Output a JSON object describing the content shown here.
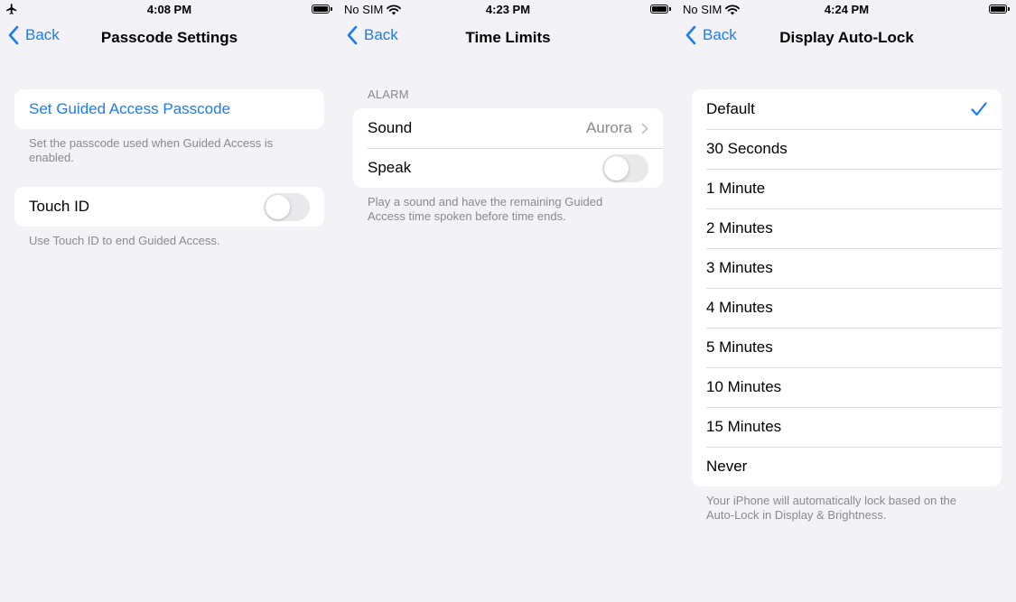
{
  "panels": [
    {
      "status": {
        "left_text": "",
        "left_icon": "airplane-icon",
        "time": "4:08 PM"
      },
      "back_label": "Back",
      "title": "Passcode Settings",
      "set_passcode": "Set Guided Access Passcode",
      "set_passcode_footer": "Set the passcode used when Guided Access is enabled.",
      "touch_id": {
        "label": "Touch ID",
        "on": false
      },
      "touch_id_footer": "Use Touch ID to end Guided Access."
    },
    {
      "status": {
        "left_text": "No SIM",
        "left_icon": "wifi-icon",
        "time": "4:23 PM"
      },
      "back_label": "Back",
      "title": "Time Limits",
      "section_header": "ALARM",
      "sound": {
        "label": "Sound",
        "value": "Aurora"
      },
      "speak": {
        "label": "Speak",
        "on": false
      },
      "footer": "Play a sound and have the remaining Guided Access time spoken before time ends."
    },
    {
      "status": {
        "left_text": "No SIM",
        "left_icon": "wifi-icon",
        "time": "4:24 PM"
      },
      "back_label": "Back",
      "title": "Display Auto-Lock",
      "options": [
        "Default",
        "30 Seconds",
        "1 Minute",
        "2 Minutes",
        "3 Minutes",
        "4 Minutes",
        "5 Minutes",
        "10 Minutes",
        "15 Minutes",
        "Never"
      ],
      "selected": "Default",
      "footer": "Your iPhone will automatically lock based on the Auto-Lock in Display & Brightness."
    }
  ],
  "colors": {
    "accent": "#1a7cf5",
    "background": "#f2f2f7",
    "secondary_text": "#8a8a8e"
  }
}
